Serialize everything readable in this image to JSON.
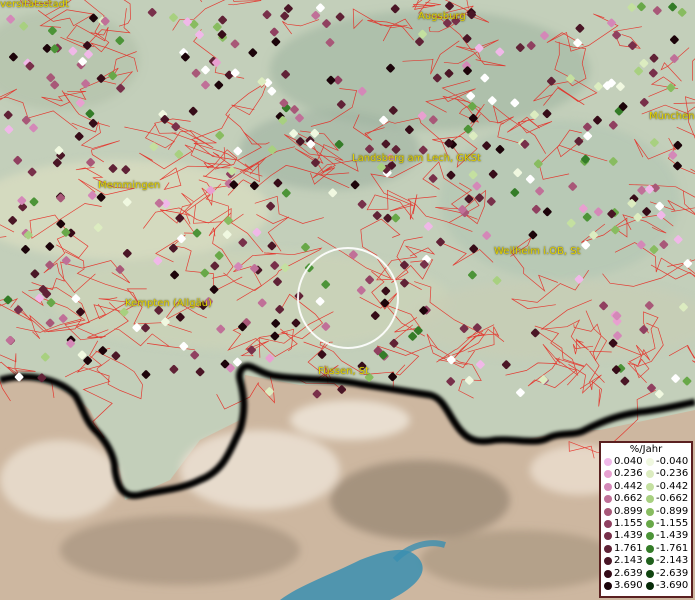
{
  "map": {
    "cities": [
      {
        "name": "Augsburg"
      },
      {
        "name": "München"
      },
      {
        "name": "Memmingen"
      },
      {
        "name": "Landsberg am Lech, GKSt"
      },
      {
        "name": "Weilheim i.OB, St"
      },
      {
        "name": "Kempten (Allgäu)"
      },
      {
        "name": "Füssen, St"
      },
      {
        "name": "versitätsstadt"
      }
    ],
    "colors": {
      "terrain_light": "#c8d4bf",
      "terrain_mid": "#9fb49a",
      "mountains": "#c9b29a",
      "boundary": "#e8221b",
      "border": "#000000",
      "water": "#3a8fb0"
    }
  },
  "legend": {
    "title": "%/Jahr",
    "positive": [
      {
        "label": "0.040",
        "color": "#f0b8e8"
      },
      {
        "label": "0.236",
        "color": "#e8a0d0"
      },
      {
        "label": "0.442",
        "color": "#d488b8"
      },
      {
        "label": "0.662",
        "color": "#c07098"
      },
      {
        "label": "0.899",
        "color": "#a85878"
      },
      {
        "label": "1.155",
        "color": "#904060"
      },
      {
        "label": "1.439",
        "color": "#78304a"
      },
      {
        "label": "1.761",
        "color": "#602236"
      },
      {
        "label": "2.143",
        "color": "#4a1626"
      },
      {
        "label": "2.639",
        "color": "#360c18"
      },
      {
        "label": "3.690",
        "color": "#1c040a"
      }
    ],
    "negative": [
      {
        "label": "-0.040",
        "color": "#f0f8e0"
      },
      {
        "label": "-0.236",
        "color": "#dcecc0"
      },
      {
        "label": "-0.442",
        "color": "#c4e0a0"
      },
      {
        "label": "-0.662",
        "color": "#a8d080"
      },
      {
        "label": "-0.899",
        "color": "#88bc60"
      },
      {
        "label": "-1.155",
        "color": "#68a848"
      },
      {
        "label": "-1.439",
        "color": "#4c9438"
      },
      {
        "label": "-1.761",
        "color": "#347c28"
      },
      {
        "label": "-2.143",
        "color": "#20601c"
      },
      {
        "label": "-2.639",
        "color": "#104410"
      },
      {
        "label": "-3.690",
        "color": "#062a08"
      }
    ]
  }
}
